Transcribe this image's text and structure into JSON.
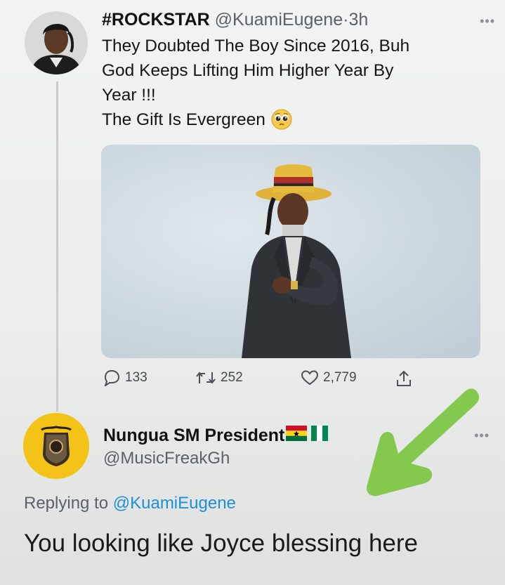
{
  "tweet": {
    "name": "#ROCKSTAR",
    "handle": "@KuamiEugene",
    "separator": "·",
    "time": "3h",
    "more_label": "•••",
    "lines": [
      "They Doubted The Boy Since 2016, Buh",
      "God Keeps Lifting Him Higher Year By",
      "Year !!!",
      "The Gift Is Evergreen"
    ],
    "emoji": "pleading-face",
    "stats": {
      "replies": "133",
      "retweets": "252",
      "likes": "2,779"
    }
  },
  "reply": {
    "name": "Nungua SM President",
    "flags": [
      "ghana-flag",
      "nigeria-flag"
    ],
    "handle": "@MusicFreakGh",
    "more_label": "•••",
    "replying_prefix": "Replying to",
    "replying_to": "@KuamiEugene",
    "text": "You looking like Joyce blessing here"
  },
  "colors": {
    "link_blue": "#1d8fd6",
    "arrow_green": "#7cc641",
    "avatar_gold": "#f3c417"
  },
  "icons": [
    "reply-icon",
    "retweet-icon",
    "like-icon",
    "share-icon",
    "more-icon"
  ]
}
